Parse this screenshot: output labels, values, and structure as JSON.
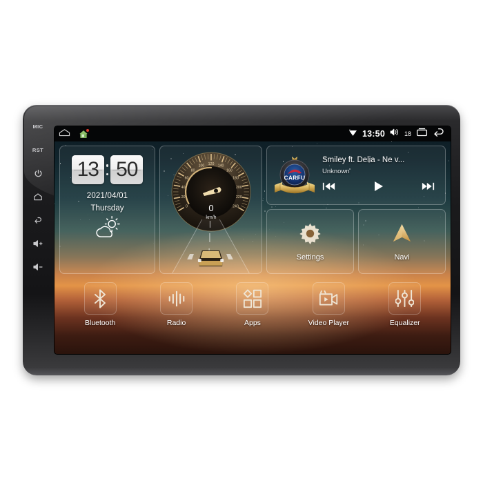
{
  "device": {
    "hard_keys": [
      {
        "name": "mic",
        "label": "MIC",
        "type": "text"
      },
      {
        "name": "reset",
        "label": "RST",
        "type": "text"
      },
      {
        "name": "power",
        "label": "",
        "type": "power-icon"
      },
      {
        "name": "home",
        "label": "",
        "type": "home-icon"
      },
      {
        "name": "back",
        "label": "",
        "type": "back-icon"
      },
      {
        "name": "volume-up",
        "label": "",
        "type": "volume-up-icon"
      },
      {
        "name": "volume-down",
        "label": "",
        "type": "volume-down-icon"
      }
    ]
  },
  "statusbar": {
    "left_icons": [
      "home-outline-icon",
      "house-badge-icon"
    ],
    "signal_icon": "wifi-signal-icon",
    "time": "13:50",
    "volume_icon": "volume-icon",
    "volume_level": "18",
    "recents_icon": "recent-apps-icon",
    "back_icon": "back-arrow-icon"
  },
  "clock_widget": {
    "hours": "13",
    "minutes": "50",
    "date": "2021/04/01",
    "weekday": "Thursday",
    "weather_icon": "partly-cloudy-icon"
  },
  "speed_widget": {
    "value": "0",
    "unit": "km/h",
    "ticks": [
      "0",
      "20",
      "40",
      "60",
      "80",
      "100",
      "120",
      "140",
      "160",
      "180",
      "200",
      "220",
      "240"
    ],
    "needle_icon": "speedometer-needle-icon",
    "road_icon": "car-on-road-icon"
  },
  "music_widget": {
    "badge_text": "CARFU",
    "badge_icon": "carfu-emblem-icon",
    "title": "Smiley ft. Delia - Ne v...",
    "artist": "Unknown",
    "controls": [
      {
        "name": "previous",
        "icon": "skip-previous-icon"
      },
      {
        "name": "play",
        "icon": "play-icon"
      },
      {
        "name": "next",
        "icon": "skip-next-icon"
      }
    ]
  },
  "shortcut_tiles": [
    {
      "label": "Settings",
      "icon": "gear-icon"
    },
    {
      "label": "Navi",
      "icon": "navigation-arrow-icon"
    }
  ],
  "dock": [
    {
      "label": "Bluetooth",
      "icon": "bluetooth-icon"
    },
    {
      "label": "Radio",
      "icon": "radio-waveform-icon"
    },
    {
      "label": "Apps",
      "icon": "apps-grid-icon"
    },
    {
      "label": "Video Player",
      "icon": "video-camera-icon"
    },
    {
      "label": "Equalizer",
      "icon": "equalizer-sliders-icon"
    }
  ],
  "colors": {
    "bezel": "#1b1b1d",
    "statusbar": "#050607",
    "accent_gold": "#e8c98a",
    "badge_red": "#e03b2f",
    "text_primary": "#ffffff"
  }
}
